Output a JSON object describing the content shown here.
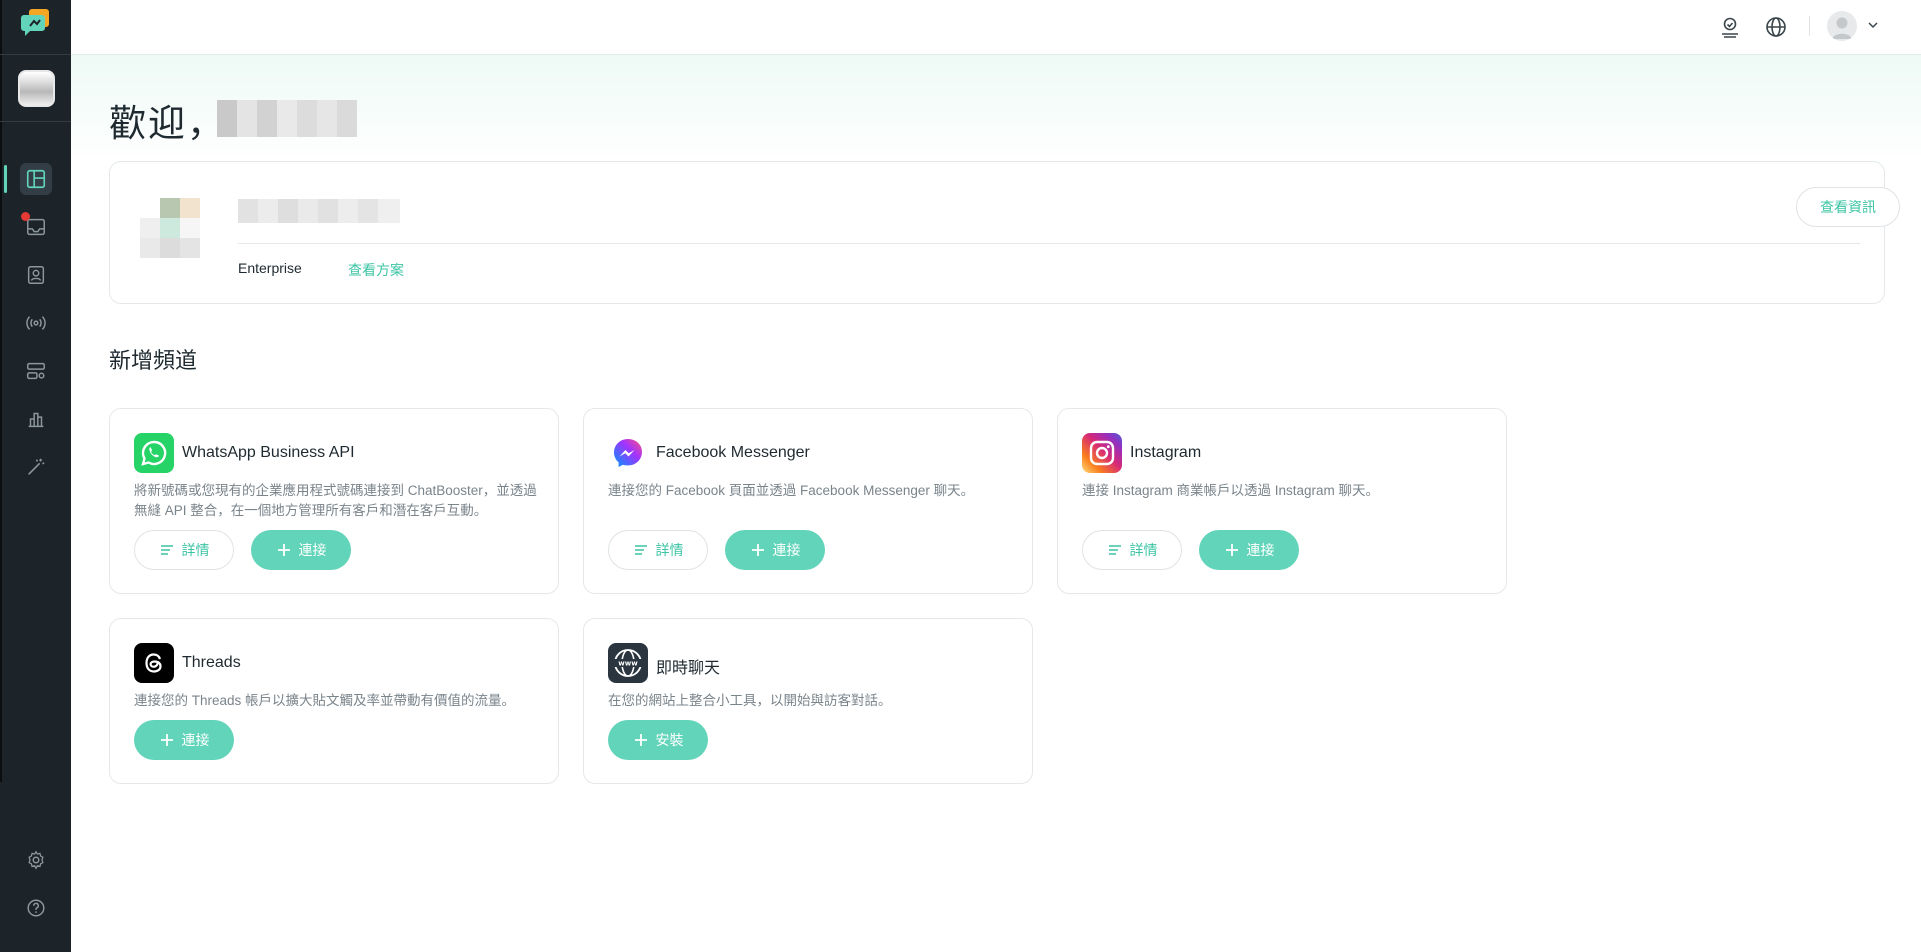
{
  "sidebar": {
    "items": [
      {
        "name": "dashboard",
        "icon": "dashboard-icon",
        "active": true
      },
      {
        "name": "inbox",
        "icon": "inbox-icon",
        "badge": true
      },
      {
        "name": "contacts",
        "icon": "contacts-icon"
      },
      {
        "name": "broadcast",
        "icon": "broadcast-icon"
      },
      {
        "name": "automation",
        "icon": "automation-icon"
      },
      {
        "name": "analytics",
        "icon": "analytics-icon"
      },
      {
        "name": "ai-tools",
        "icon": "magic-wand-icon"
      }
    ],
    "bottom": [
      {
        "name": "settings",
        "icon": "gear-icon"
      },
      {
        "name": "help",
        "icon": "help-icon"
      }
    ]
  },
  "topbar": {
    "icons": [
      "agent-status-icon",
      "globe-icon",
      "user-avatar",
      "chevron-down-icon"
    ]
  },
  "welcome": {
    "greeting": "歡迎，"
  },
  "org": {
    "plan": "Enterprise",
    "plan_link": "查看方案",
    "info_button": "查看資訊"
  },
  "channels": {
    "section_title": "新增頻道",
    "detail_label": "詳情",
    "connect_label": "連接",
    "install_label": "安裝",
    "items": [
      {
        "name": "WhatsApp Business API",
        "desc": "將新號碼或您現有的企業應用程式號碼連接到 ChatBooster，並透過無縫 API 整合，在一個地方管理所有客戶和潛在客戶互動。",
        "icon": "whatsapp-icon",
        "color": "#25d366"
      },
      {
        "name": "Facebook Messenger",
        "desc": "連接您的 Facebook 頁面並透過 Facebook Messenger 聊天。",
        "icon": "messenger-icon",
        "color": "#7b4dff"
      },
      {
        "name": "Instagram",
        "desc": "連接 Instagram 商業帳戶以透過 Instagram 聊天。",
        "icon": "instagram-icon",
        "color": "#e1306c"
      },
      {
        "name": "Threads",
        "desc": "連接您的 Threads 帳戶以擴大貼文觸及率並帶動有價值的流量。",
        "icon": "threads-icon",
        "color": "#000000"
      },
      {
        "name": "即時聊天",
        "desc": "在您的網站上整合小工具，以開始與訪客對話。",
        "icon": "www-globe-icon",
        "color": "#2b3540"
      }
    ]
  },
  "colors": {
    "accent": "#62d4b9",
    "accent_text": "#3cc4a4",
    "sidebar_bg": "#1c2329"
  }
}
